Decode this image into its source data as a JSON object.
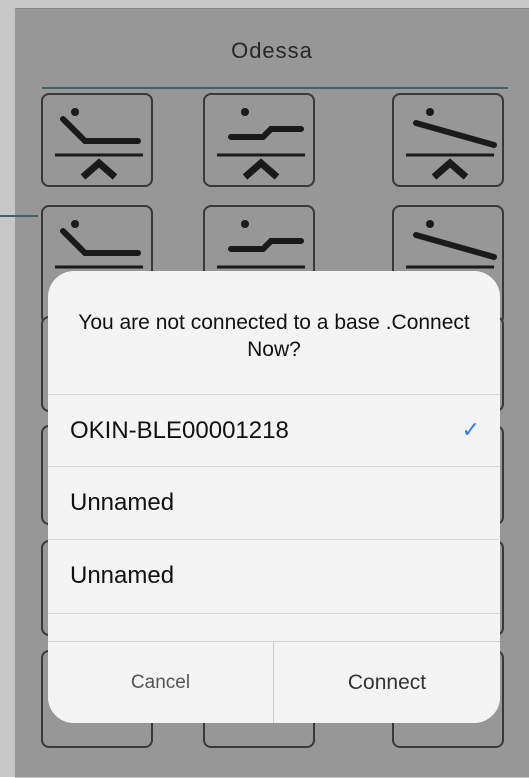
{
  "header": {
    "title": "Odessa"
  },
  "grid": {
    "buttons": [
      {
        "icon": "head-up-raise-icon"
      },
      {
        "icon": "flat-raise-icon"
      },
      {
        "icon": "feet-up-raise-icon"
      },
      {
        "icon": "head-up-lower-icon"
      },
      {
        "icon": "flat-lower-icon"
      },
      {
        "icon": "feet-up-lower-icon"
      }
    ]
  },
  "dialog": {
    "message": "You are not connected to a base .Connect Now?",
    "options": [
      {
        "label": "OKIN-BLE00001218",
        "selected": true
      },
      {
        "label": "Unnamed",
        "selected": false
      },
      {
        "label": "Unnamed",
        "selected": false
      }
    ],
    "check_symbol": "✓",
    "cancel_label": "Cancel",
    "connect_label": "Connect"
  },
  "colors": {
    "background": "#c2c2c2",
    "accent_rule": "#5a7a85",
    "check": "#2a7ff5"
  }
}
